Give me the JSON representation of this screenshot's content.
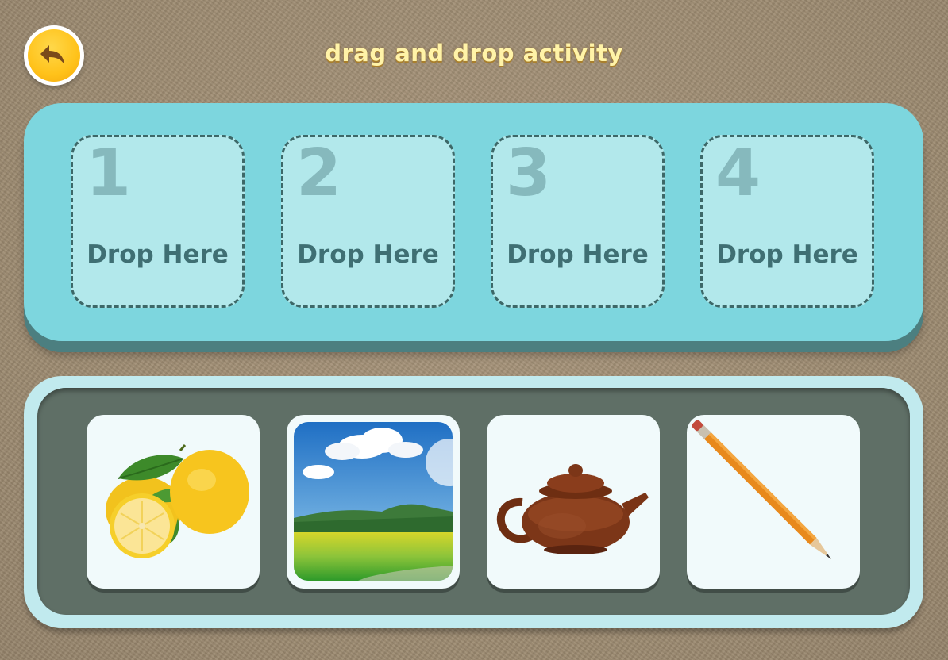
{
  "header": {
    "back_button_icon": "undo-arrow-icon",
    "title": "drag and drop activity"
  },
  "drop_zones": [
    {
      "number": "1",
      "label": "Drop Here"
    },
    {
      "number": "2",
      "label": "Drop Here"
    },
    {
      "number": "3",
      "label": "Drop Here"
    },
    {
      "number": "4",
      "label": "Drop Here"
    }
  ],
  "items": [
    {
      "icon": "lemons-image"
    },
    {
      "icon": "landscape-image"
    },
    {
      "icon": "teapot-image"
    },
    {
      "icon": "pencil-image"
    }
  ],
  "colors": {
    "accent_yellow": "#ffc21a",
    "drop_panel": "#7dd6de",
    "drop_zone": "#b2e8eb",
    "items_panel": "#c1eaee",
    "items_inner": "#5f6f66"
  }
}
